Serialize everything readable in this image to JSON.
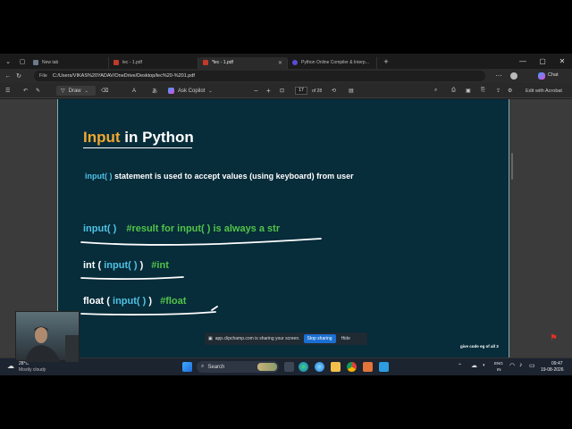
{
  "browser": {
    "tabs": [
      {
        "label": "New tab",
        "color": "#6c7a89"
      },
      {
        "label": "lec - 1.pdf",
        "color": "#c0392b"
      },
      {
        "label": "*lec - 1.pdf",
        "color": "#c0392b"
      },
      {
        "label": "Python Online Compiler & Interp...",
        "color": "#5b4bd6"
      }
    ],
    "new_tab": "+",
    "address": {
      "label": "File",
      "url": "C:/Users/VIKAS%20YADAV/OneDrive/Desktop/lec%20-%201.pdf"
    },
    "window_controls": {
      "minimize": "—",
      "maximize": "▢",
      "close": "✕"
    },
    "profile": "Chat"
  },
  "pdf_toolbar": {
    "draw_label": "Draw",
    "copilot_label": "Ask Copilot",
    "zoom_minus": "−",
    "zoom_plus": "+",
    "current_page": "17",
    "page_total": "of 28",
    "edit_label": "Edit with Acrobat"
  },
  "slide": {
    "title_word1": "Input",
    "title_word2": "in Python",
    "desc_keyword": "input( )",
    "desc_text": "statement is used to accept values (using keyboard) from user",
    "line1_code": "input( )",
    "line1_comment": "#result for input( ) is always a str",
    "line2_prefix": "int (",
    "line2_code": "input( )",
    "line2_suffix": ")",
    "line2_comment": "#int",
    "line3_prefix": "float (",
    "line3_code": "input( )",
    "line3_suffix": ")",
    "line3_comment": "#float",
    "footer": "give code eg of all 3",
    "colors": {
      "bg": "#072c3a",
      "orange": "#f0a930",
      "cyan": "#4fc3e6",
      "green": "#52c448",
      "white": "#ffffff"
    }
  },
  "share_bar": {
    "text": "app.clipchamp.com is sharing your screen.",
    "stop_label": "Stop sharing",
    "hide_label": "Hide"
  },
  "taskbar": {
    "weather_temp": "28°C",
    "weather_desc": "Mostly cloudy",
    "search_label": "Search",
    "lang_top": "ENG",
    "lang_bottom": "IN",
    "time": "09:47",
    "date": "19-08-2026"
  }
}
